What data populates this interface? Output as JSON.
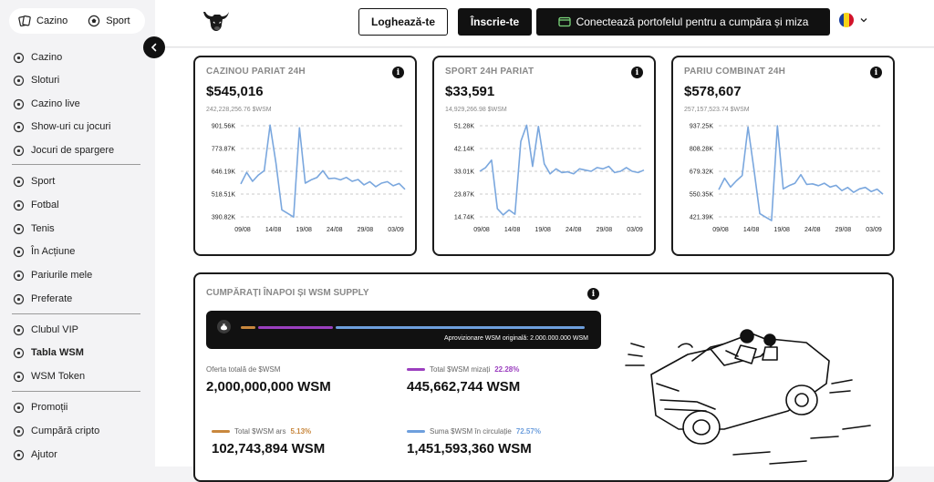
{
  "switch": {
    "casino": "Cazino",
    "sport": "Sport"
  },
  "sidebar": {
    "items": [
      {
        "label": "Cazino",
        "icon": "cards-icon"
      },
      {
        "label": "Sloturi",
        "icon": "slot-machine-icon"
      },
      {
        "label": "Cazino live",
        "icon": "live-casino-icon"
      },
      {
        "label": "Show-uri cu jocuri",
        "icon": "game-show-icon"
      },
      {
        "label": "Jocuri de spargere",
        "icon": "rocket-icon"
      },
      {
        "label": "Sport",
        "icon": "sport-icon"
      },
      {
        "label": "Fotbal",
        "icon": "football-icon"
      },
      {
        "label": "Tenis",
        "icon": "tennis-icon"
      },
      {
        "label": "În Acțiune",
        "icon": "live-action-icon"
      },
      {
        "label": "Pariurile mele",
        "icon": "my-bets-icon"
      },
      {
        "label": "Preferate",
        "icon": "star-icon"
      },
      {
        "label": "Clubul VIP",
        "icon": "vip-icon"
      },
      {
        "label": "Tabla WSM",
        "icon": "leaderboard-icon"
      },
      {
        "label": "WSM Token",
        "icon": "token-icon"
      },
      {
        "label": "Promoții",
        "icon": "gift-icon"
      },
      {
        "label": "Cumpără cripto",
        "icon": "buy-crypto-icon"
      },
      {
        "label": "Ajutor",
        "icon": "help-icon"
      }
    ]
  },
  "header": {
    "login": "Loghează-te",
    "signup": "Înscrie-te",
    "wallet": "Conectează portofelul pentru a cumpăra și miza",
    "language": "Romanian flag"
  },
  "cards": [
    {
      "title": "CAZINOU PARIAT 24H",
      "value": "$545,016",
      "sub": "242,228,256.76 $WSM"
    },
    {
      "title": "SPORT 24H PARIAT",
      "value": "$33,591",
      "sub": "14,929,266.98 $WSM"
    },
    {
      "title": "PARIU COMBINAT 24H",
      "value": "$578,607",
      "sub": "257,157,523.74 $WSM"
    }
  ],
  "chart_data": [
    {
      "type": "line",
      "title": "CAZINOU PARIAT 24H",
      "x_ticks": [
        "09/08",
        "14/08",
        "19/08",
        "24/08",
        "29/08",
        "03/09"
      ],
      "y_ticks": [
        "901.56K",
        "773.87K",
        "646.19K",
        "518.51K",
        "390.82K"
      ],
      "ylim": [
        390820,
        901560
      ],
      "grid": "horizontal dashed",
      "color": "#7aa7de",
      "values": [
        575000,
        640000,
        590000,
        625000,
        650000,
        905000,
        690000,
        430000,
        410000,
        390000,
        890000,
        580000,
        598000,
        612000,
        650000,
        605000,
        608000,
        598000,
        612000,
        590000,
        600000,
        570000,
        588000,
        560000,
        580000,
        588000,
        565000,
        578000,
        545000
      ]
    },
    {
      "type": "line",
      "title": "SPORT 24H PARIAT",
      "x_ticks": [
        "09/08",
        "14/08",
        "19/08",
        "24/08",
        "29/08",
        "03/09"
      ],
      "y_ticks": [
        "51.28K",
        "42.14K",
        "33.01K",
        "23.87K",
        "14.74K"
      ],
      "ylim": [
        14740,
        51280
      ],
      "grid": "horizontal dashed",
      "color": "#7aa7de",
      "values": [
        33000,
        34500,
        37500,
        18000,
        15500,
        17500,
        15800,
        45000,
        51500,
        35000,
        51000,
        36000,
        32000,
        34000,
        32500,
        32800,
        32000,
        34000,
        33500,
        33000,
        34500,
        34000,
        35000,
        32500,
        33000,
        34500,
        33000,
        32500,
        33500
      ]
    },
    {
      "type": "line",
      "title": "PARIU COMBINAT 24H",
      "x_ticks": [
        "09/08",
        "14/08",
        "19/08",
        "24/08",
        "29/08",
        "03/09"
      ],
      "y_ticks": [
        "937.25K",
        "808.28K",
        "679.32K",
        "550.35K",
        "421.39K"
      ],
      "ylim": [
        421390,
        937250
      ],
      "grid": "horizontal dashed",
      "color": "#7aa7de",
      "values": [
        575000,
        640000,
        590000,
        625000,
        655000,
        930000,
        690000,
        440000,
        420000,
        400000,
        937000,
        580000,
        598000,
        612000,
        660000,
        605000,
        608000,
        598000,
        612000,
        590000,
        600000,
        570000,
        588000,
        560000,
        580000,
        588000,
        565000,
        578000,
        550000
      ]
    }
  ],
  "buyback": {
    "title": "CUMPĂRAȚI ÎNAPOI ȘI WSM SUPPLY",
    "original_supply": "Aprovizionare WSM originală: 2.000.000.000 WSM",
    "segments": [
      {
        "name": "burned",
        "fraction": 0.0513,
        "color": "#c8873d"
      },
      {
        "name": "staked",
        "fraction": 0.2228,
        "color": "#9b3fbf"
      },
      {
        "name": "circulating",
        "fraction": 0.7257,
        "color": "#6e9fdd"
      }
    ],
    "stats": {
      "total": {
        "label": "Oferta totală de $WSM",
        "value": "2,000,000,000 WSM"
      },
      "staked": {
        "label": "Total $WSM mizați",
        "pct": "22.28%",
        "value": "445,662,744 WSM",
        "color": "#9b3fbf"
      },
      "burned": {
        "label": "Total $WSM ars",
        "pct": "5.13%",
        "value": "102,743,894 WSM",
        "color": "#c8873d"
      },
      "circulating": {
        "label": "Suma $WSM în circulație",
        "pct": "72.57%",
        "value": "1,451,593,360 WSM",
        "color": "#6e9fdd"
      }
    }
  }
}
